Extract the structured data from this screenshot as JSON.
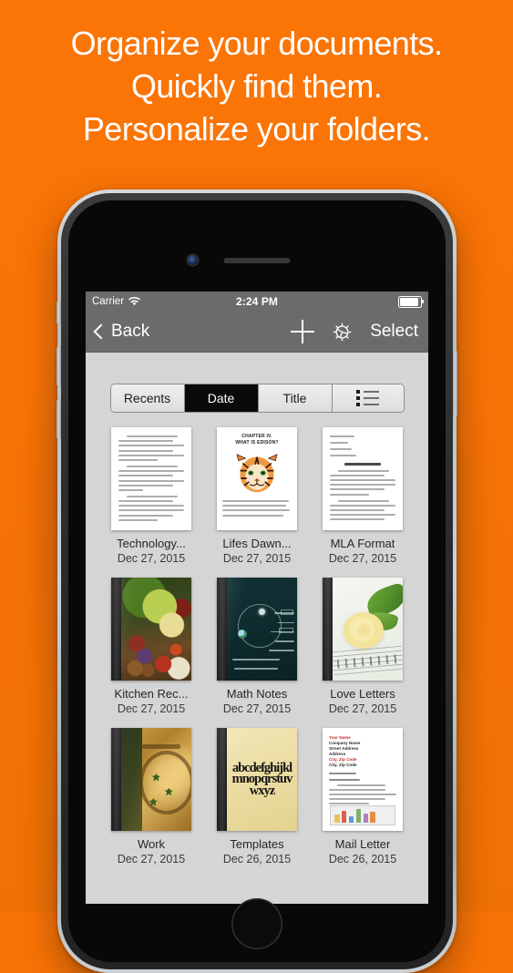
{
  "marketing": {
    "headline_lines": [
      "Organize your documents.",
      "Quickly find them.",
      "Personalize your folders."
    ],
    "background_color": "#f97306",
    "text_color": "#ffffff"
  },
  "status_bar": {
    "carrier": "Carrier",
    "wifi_icon": "wifi-icon",
    "time": "2:24 PM",
    "battery_icon": "battery-full-icon"
  },
  "nav_bar": {
    "back_label": "Back",
    "back_icon": "chevron-left-icon",
    "add_icon": "plus-icon",
    "settings_icon": "gear-icon",
    "select_label": "Select",
    "background_color": "#6b6b6b"
  },
  "segmented_control": {
    "options": [
      {
        "label": "Recents",
        "selected": false
      },
      {
        "label": "Date",
        "selected": true
      },
      {
        "label": "Title",
        "selected": false
      }
    ],
    "view_toggle_icon": "list-view-icon",
    "selected_color": "#0a0a0a"
  },
  "documents": [
    {
      "title": "Technology...",
      "date": "Dec 27, 2015",
      "thumbnail": "essay-page"
    },
    {
      "title": "Lifes Dawn...",
      "date": "Dec 27, 2015",
      "thumbnail": "tiger-chapter-page"
    },
    {
      "title": "MLA Format",
      "date": "Dec 27, 2015",
      "thumbnail": "mla-essay-page"
    },
    {
      "title": "Kitchen Rec...",
      "date": "Dec 27, 2015",
      "thumbnail": "food-photo-cover"
    },
    {
      "title": "Math Notes",
      "date": "Dec 27, 2015",
      "thumbnail": "math-diagram-cover"
    },
    {
      "title": "Love Letters",
      "date": "Dec 27, 2015",
      "thumbnail": "yellow-rose-cover"
    },
    {
      "title": "Work",
      "date": "Dec 27, 2015",
      "thumbnail": "illuminated-manuscript-cover"
    },
    {
      "title": "Templates",
      "date": "Dec 26, 2015",
      "thumbnail": "alphabet-typography-cover"
    },
    {
      "title": "Mail Letter",
      "date": "Dec 26, 2015",
      "thumbnail": "business-letterhead-page"
    }
  ],
  "thumbnail_text": {
    "tiger_chapter": "CHAPTER IV.\nWHAT IS EDISON?",
    "alphabet": "abcdefghijklmnopqrstuvwxyz",
    "letterhead_lines": [
      "Your Name",
      "Company Name",
      "Street Address",
      "Address",
      "City, Zip Code",
      "City, Zip Code"
    ]
  },
  "device": {
    "frame_color": "#c6c9cb",
    "screen_background": "#d5d5d5"
  }
}
